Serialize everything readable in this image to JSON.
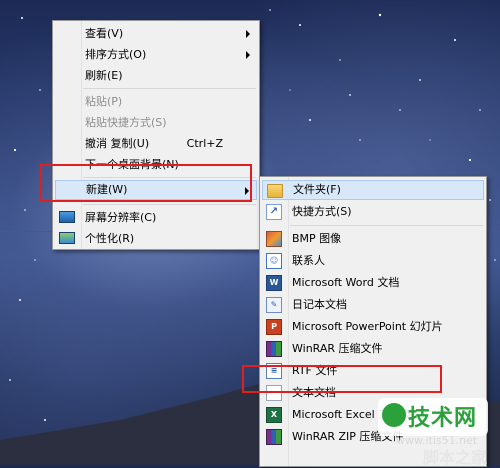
{
  "context_menu": {
    "items": [
      {
        "label": "查看(V)",
        "has_submenu": true,
        "disabled": false
      },
      {
        "label": "排序方式(O)",
        "has_submenu": true,
        "disabled": false
      },
      {
        "label": "刷新(E)",
        "has_submenu": false,
        "disabled": false
      },
      {
        "label": "粘贴(P)",
        "has_submenu": false,
        "disabled": true
      },
      {
        "label": "粘贴快捷方式(S)",
        "has_submenu": false,
        "disabled": true
      },
      {
        "label": "撤消 复制(U)",
        "shortcut": "Ctrl+Z",
        "has_submenu": false,
        "disabled": false
      },
      {
        "label": "下一个桌面背景(N)",
        "has_submenu": false,
        "disabled": false
      },
      {
        "label": "新建(W)",
        "has_submenu": true,
        "disabled": false,
        "highlighted": true
      },
      {
        "label": "屏幕分辨率(C)",
        "icon": "monitor-icon",
        "has_submenu": false,
        "disabled": false
      },
      {
        "label": "个性化(R)",
        "icon": "personalize-icon",
        "has_submenu": false,
        "disabled": false
      }
    ]
  },
  "new_submenu": {
    "items": [
      {
        "label": "文件夹(F)",
        "icon": "folder-icon",
        "highlighted": true
      },
      {
        "label": "快捷方式(S)",
        "icon": "shortcut-icon"
      },
      {
        "label": "BMP 图像",
        "icon": "bmp-image-icon"
      },
      {
        "label": "联系人",
        "icon": "contact-icon"
      },
      {
        "label": "Microsoft Word 文档",
        "icon": "word-document-icon"
      },
      {
        "label": "日记本文档",
        "icon": "journal-document-icon"
      },
      {
        "label": "Microsoft PowerPoint 幻灯片",
        "icon": "powerpoint-icon"
      },
      {
        "label": "WinRAR 压缩文件",
        "icon": "winrar-icon"
      },
      {
        "label": "RTF 文件",
        "icon": "rtf-file-icon"
      },
      {
        "label": "文本文档",
        "icon": "text-document-icon"
      },
      {
        "label": "Microsoft Excel 工作表",
        "icon": "excel-icon"
      },
      {
        "label": "WinRAR ZIP 压缩文件",
        "icon": "winrar-zip-icon"
      }
    ]
  },
  "watermark": {
    "badge_text": "技术网",
    "url": "www.itis51.net",
    "cn_text": "脚本之家"
  },
  "colors": {
    "annotation_red": "#e02020",
    "menu_background": "#f0f0f0",
    "highlight_fill": "#d9e8f8",
    "highlight_border": "#aacbef"
  }
}
